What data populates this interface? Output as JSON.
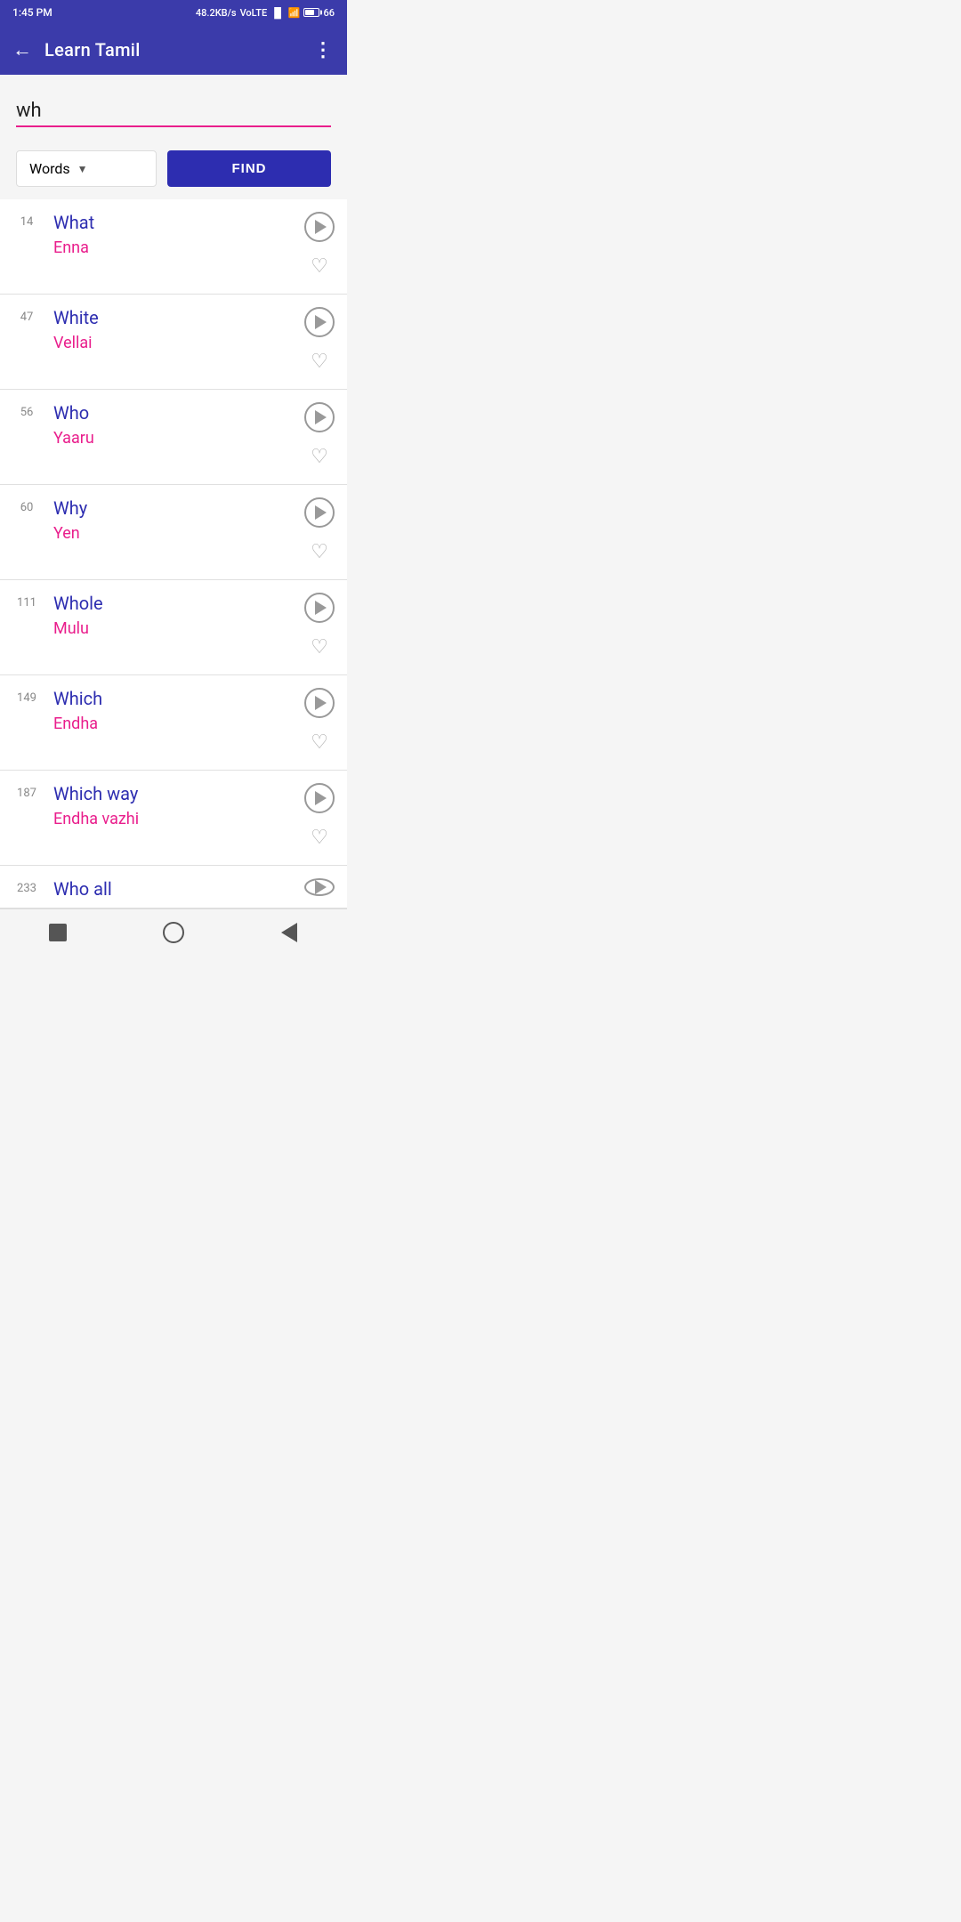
{
  "statusBar": {
    "time": "1:45 PM",
    "network": "48.2KB/s",
    "networkType": "VoLTE",
    "battery": "66"
  },
  "appBar": {
    "title": "Learn Tamil",
    "backLabel": "←",
    "moreLabel": "⋮"
  },
  "search": {
    "value": "wh",
    "placeholder": ""
  },
  "filter": {
    "dropdownLabel": "Words",
    "findLabel": "FIND"
  },
  "words": [
    {
      "id": 1,
      "number": "14",
      "english": "What",
      "tamil": "Enna"
    },
    {
      "id": 2,
      "number": "47",
      "english": "White",
      "tamil": "Vellai"
    },
    {
      "id": 3,
      "number": "56",
      "english": "Who",
      "tamil": "Yaaru"
    },
    {
      "id": 4,
      "number": "60",
      "english": "Why",
      "tamil": "Yen"
    },
    {
      "id": 5,
      "number": "111",
      "english": "Whole",
      "tamil": "Mulu"
    },
    {
      "id": 6,
      "number": "149",
      "english": "Which",
      "tamil": "Endha"
    },
    {
      "id": 7,
      "number": "187",
      "english": "Which way",
      "tamil": "Endha vazhi"
    },
    {
      "id": 8,
      "number": "233",
      "english": "Who all",
      "tamil": ""
    }
  ],
  "bottomNav": {
    "square": "stop",
    "circle": "home",
    "triangle": "back"
  }
}
